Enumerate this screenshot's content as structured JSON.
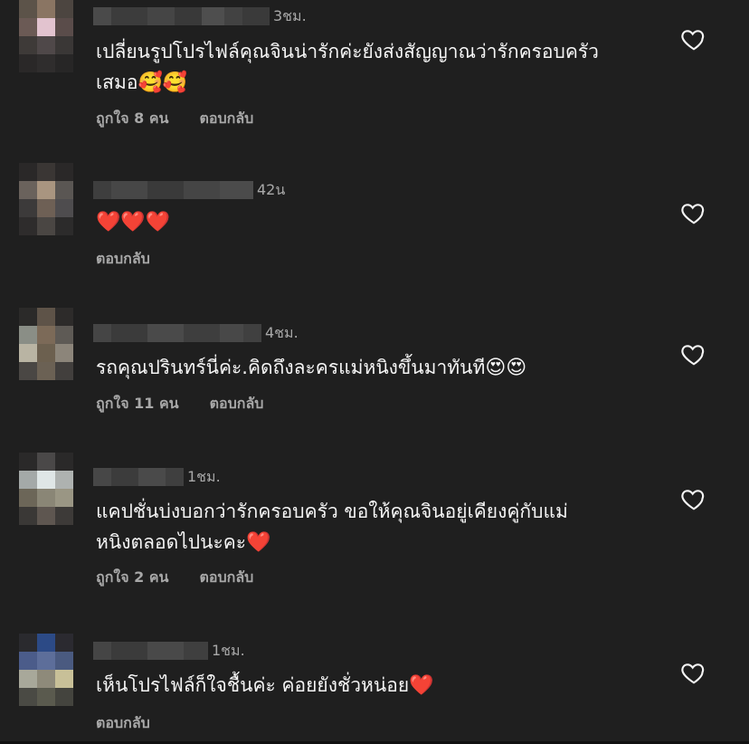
{
  "colors": {
    "background": "#1f1f1f",
    "text": "#f5f5f5",
    "muted": "#a8a8a8",
    "heart_emoji": "#e0273a"
  },
  "comments": [
    {
      "time": "3ชม.",
      "text": "เปลี่ยนรูปโปรไฟล์คุณจินน่ารักค่ะยังส่งสัญญาณว่ารักครอบครัว",
      "text2": "เสมอ",
      "emoji": "🥰🥰",
      "likes": "ถูกใจ 8 คน",
      "reply": "ตอบกลับ",
      "like_icon": "heart-outline-icon"
    },
    {
      "time": "42น",
      "text": "",
      "emoji": "❤️❤️❤️",
      "likes": "",
      "reply": "ตอบกลับ",
      "like_icon": "heart-outline-icon"
    },
    {
      "time": "4ชม.",
      "text": "รถคุณปรินทร์นี่ค่ะ.คิดถึงละครแม่หนิงขึ้นมาทันที",
      "emoji": "😍😍",
      "likes": "ถูกใจ 11 คน",
      "reply": "ตอบกลับ",
      "like_icon": "heart-outline-icon"
    },
    {
      "time": "1ชม.",
      "text": "แคปชั่นบ่งบอกว่ารักครอบครัว ขอให้คุณจินอยู่เคียงคู่กับแม่",
      "text2": "หนิงตลอดไปนะคะ",
      "emoji": "❤️",
      "likes": "ถูกใจ 2 คน",
      "reply": "ตอบกลับ",
      "like_icon": "heart-outline-icon"
    },
    {
      "time": "1ชม.",
      "text": "เห็นโปรไฟล์ก็ใจชื้นค่ะ ค่อยยังชั่วหน่อย",
      "emoji": "❤️",
      "likes": "",
      "reply": "ตอบกลับ",
      "like_icon": "heart-outline-icon"
    }
  ]
}
